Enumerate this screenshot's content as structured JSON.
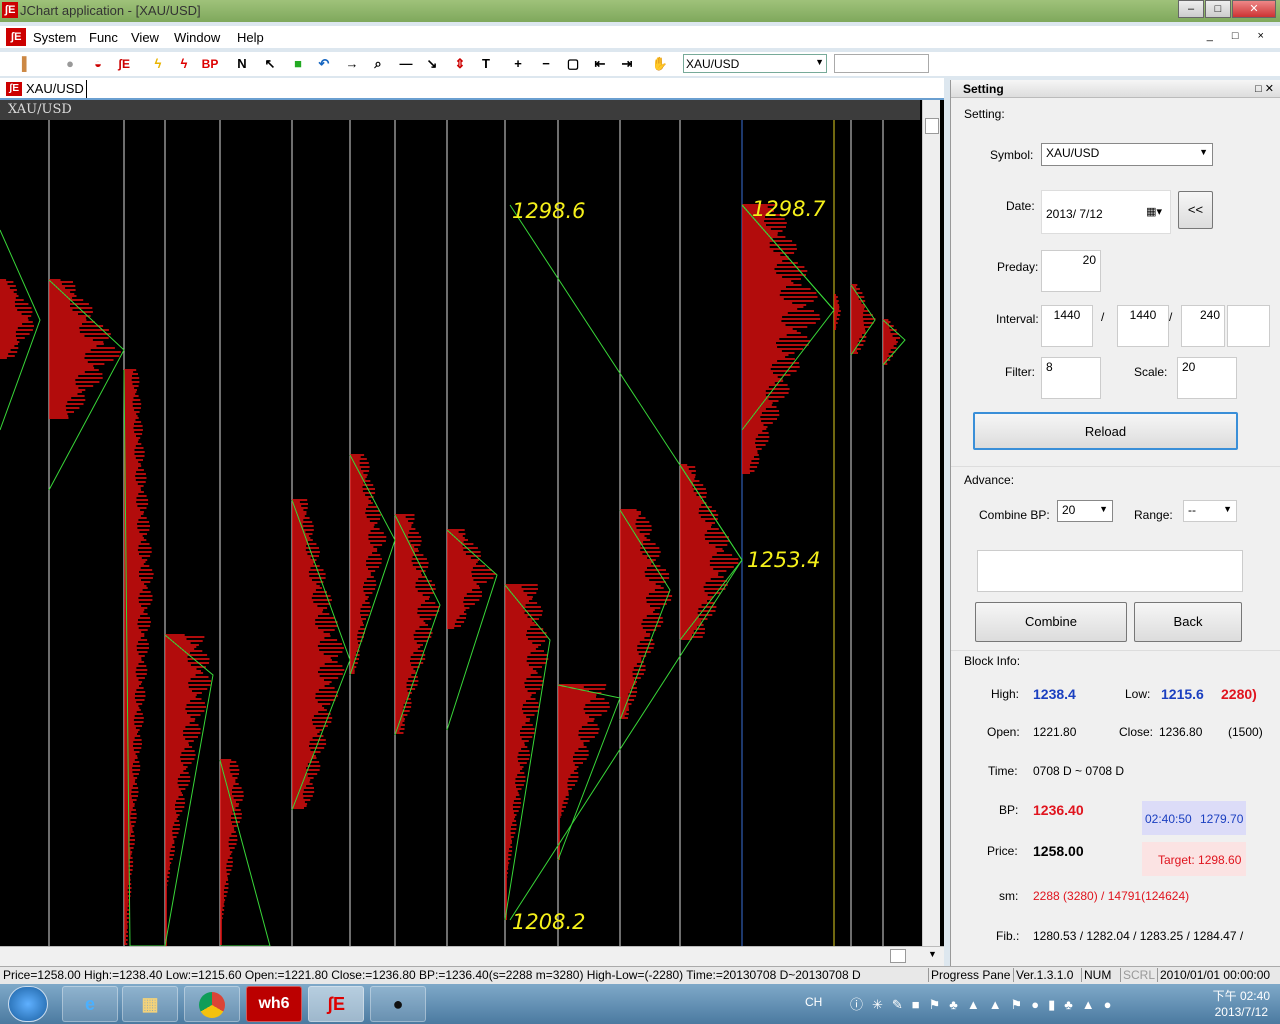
{
  "window": {
    "title": "JChart application - [XAU/USD]",
    "minimize": "–",
    "maximize": "□",
    "close": "✕"
  },
  "menu": {
    "items": [
      "System",
      "Func",
      "View",
      "Window",
      "Help"
    ],
    "mdi_controls": "_ □ ×"
  },
  "toolbar": {
    "buttons": [
      {
        "icon": "bar-chart-icon",
        "glyph": "▐",
        "color": "#c84"
      },
      {
        "icon": "record-icon",
        "glyph": "●",
        "color": "#999"
      },
      {
        "icon": "car-icon",
        "glyph": "◒",
        "color": "#c00"
      },
      {
        "icon": "jchart-logo-icon",
        "glyph": "ʃE",
        "color": "#c00"
      },
      {
        "icon": "lightning-yellow-icon",
        "glyph": "ϟ",
        "color": "#e9b400"
      },
      {
        "icon": "lightning-red-icon",
        "glyph": "ϟ",
        "color": "#d00"
      },
      {
        "icon": "bp-icon",
        "glyph": "BP",
        "color": "#d00"
      },
      {
        "icon": "n-icon",
        "glyph": "N",
        "color": "#000"
      },
      {
        "icon": "pointer-icon",
        "glyph": "↖",
        "color": "#000"
      },
      {
        "icon": "cube-icon",
        "glyph": "■",
        "color": "#2a2"
      },
      {
        "icon": "undo-icon",
        "glyph": "↶",
        "color": "#1565c0"
      },
      {
        "icon": "next-icon",
        "glyph": "→",
        "color": "#000"
      },
      {
        "icon": "zoom-icon",
        "glyph": "⌕",
        "color": "#000"
      },
      {
        "icon": "hline-icon",
        "glyph": "—",
        "color": "#000"
      },
      {
        "icon": "trendline-icon",
        "glyph": "↘",
        "color": "#000"
      },
      {
        "icon": "updown-icon",
        "glyph": "⇕",
        "color": "#c00"
      },
      {
        "icon": "text-icon",
        "glyph": "T",
        "color": "#000"
      },
      {
        "icon": "plus-icon",
        "glyph": "+",
        "color": "#000"
      },
      {
        "icon": "minus-icon",
        "glyph": "−",
        "color": "#000"
      },
      {
        "icon": "select-rect-icon",
        "glyph": "▢",
        "color": "#000"
      },
      {
        "icon": "scroll-left-icon",
        "glyph": "⇤",
        "color": "#000"
      },
      {
        "icon": "scroll-right-icon",
        "glyph": "⇥",
        "color": "#000"
      },
      {
        "icon": "hand-icon",
        "glyph": "✋",
        "color": "#000"
      }
    ],
    "symbol": "XAU/USD"
  },
  "doc_tab": {
    "label": "XAU/USD"
  },
  "chart": {
    "header": "XAU/USD",
    "price_labels": [
      "1298.6",
      "1298.7",
      "1253.4",
      "1208.2"
    ]
  },
  "setting": {
    "title": "Setting",
    "section_setting": "Setting:",
    "symbol_label": "Symbol:",
    "symbol_value": "XAU/USD",
    "date_label": "Date:",
    "date_value": "2013/  7/12",
    "date_back": "<<",
    "preday_label": "Preday:",
    "preday_value": "20",
    "interval_label": "Interval:",
    "interval_1": "1440",
    "interval_2": "1440",
    "interval_3": "240",
    "interval_sep": "/",
    "filter_label": "Filter:",
    "filter_value": "8",
    "scale_label": "Scale:",
    "scale_value": "20",
    "reload": "Reload",
    "section_advance": "Advance:",
    "combine_bp_label": "Combine BP:",
    "combine_bp_value": "20",
    "range_label": "Range:",
    "range_value": "--",
    "combine": "Combine",
    "back": "Back",
    "section_block": "Block Info:",
    "high_label": "High:",
    "high_value": "1238.4",
    "low_label": "Low:",
    "low_value": "1215.6",
    "low_extra": "2280)",
    "open_label": "Open:",
    "open_value": "1221.80",
    "close_label": "Close:",
    "close_value": "1236.80",
    "close_extra": "(1500)",
    "time_label": "Time:",
    "time_value": "0708 D ~ 0708 D",
    "bp_label": "BP:",
    "bp_value": "1236.40",
    "bp_time": "02:40:50",
    "bp_time_price": "1279.70",
    "price_label": "Price:",
    "price_value": "1258.00",
    "target": "Target: 1298.60",
    "sm_label": "sm:",
    "sm_value": "2288 (3280) / 14791(124624)",
    "fib_label": "Fib.:",
    "fib_value": "1280.53 / 1282.04 / 1283.25 / 1284.47 /"
  },
  "status": {
    "main": "Price=1258.00  High:=1238.40  Low:=1215.60  Open:=1221.80  Close:=1236.80  BP:=1236.40(s=2288 m=3280)  High-Low=(-2280)  Time:=20130708 D~20130708 D",
    "progress": "Progress Pane",
    "version": "Ver.1.3.1.0",
    "num": "NUM",
    "scrl": "SCRL",
    "datetime": "2010/01/01 00:00:00"
  },
  "taskbar": {
    "apps": [
      "ie-app",
      "explorer-app",
      "chrome-app",
      "wh6-app",
      "jchart-app",
      "qq-app"
    ],
    "wh6_label": "wh6",
    "jchart_label": "ʃE",
    "lang": "CH",
    "time": "下午 02:40",
    "date": "2013/7/12"
  }
}
